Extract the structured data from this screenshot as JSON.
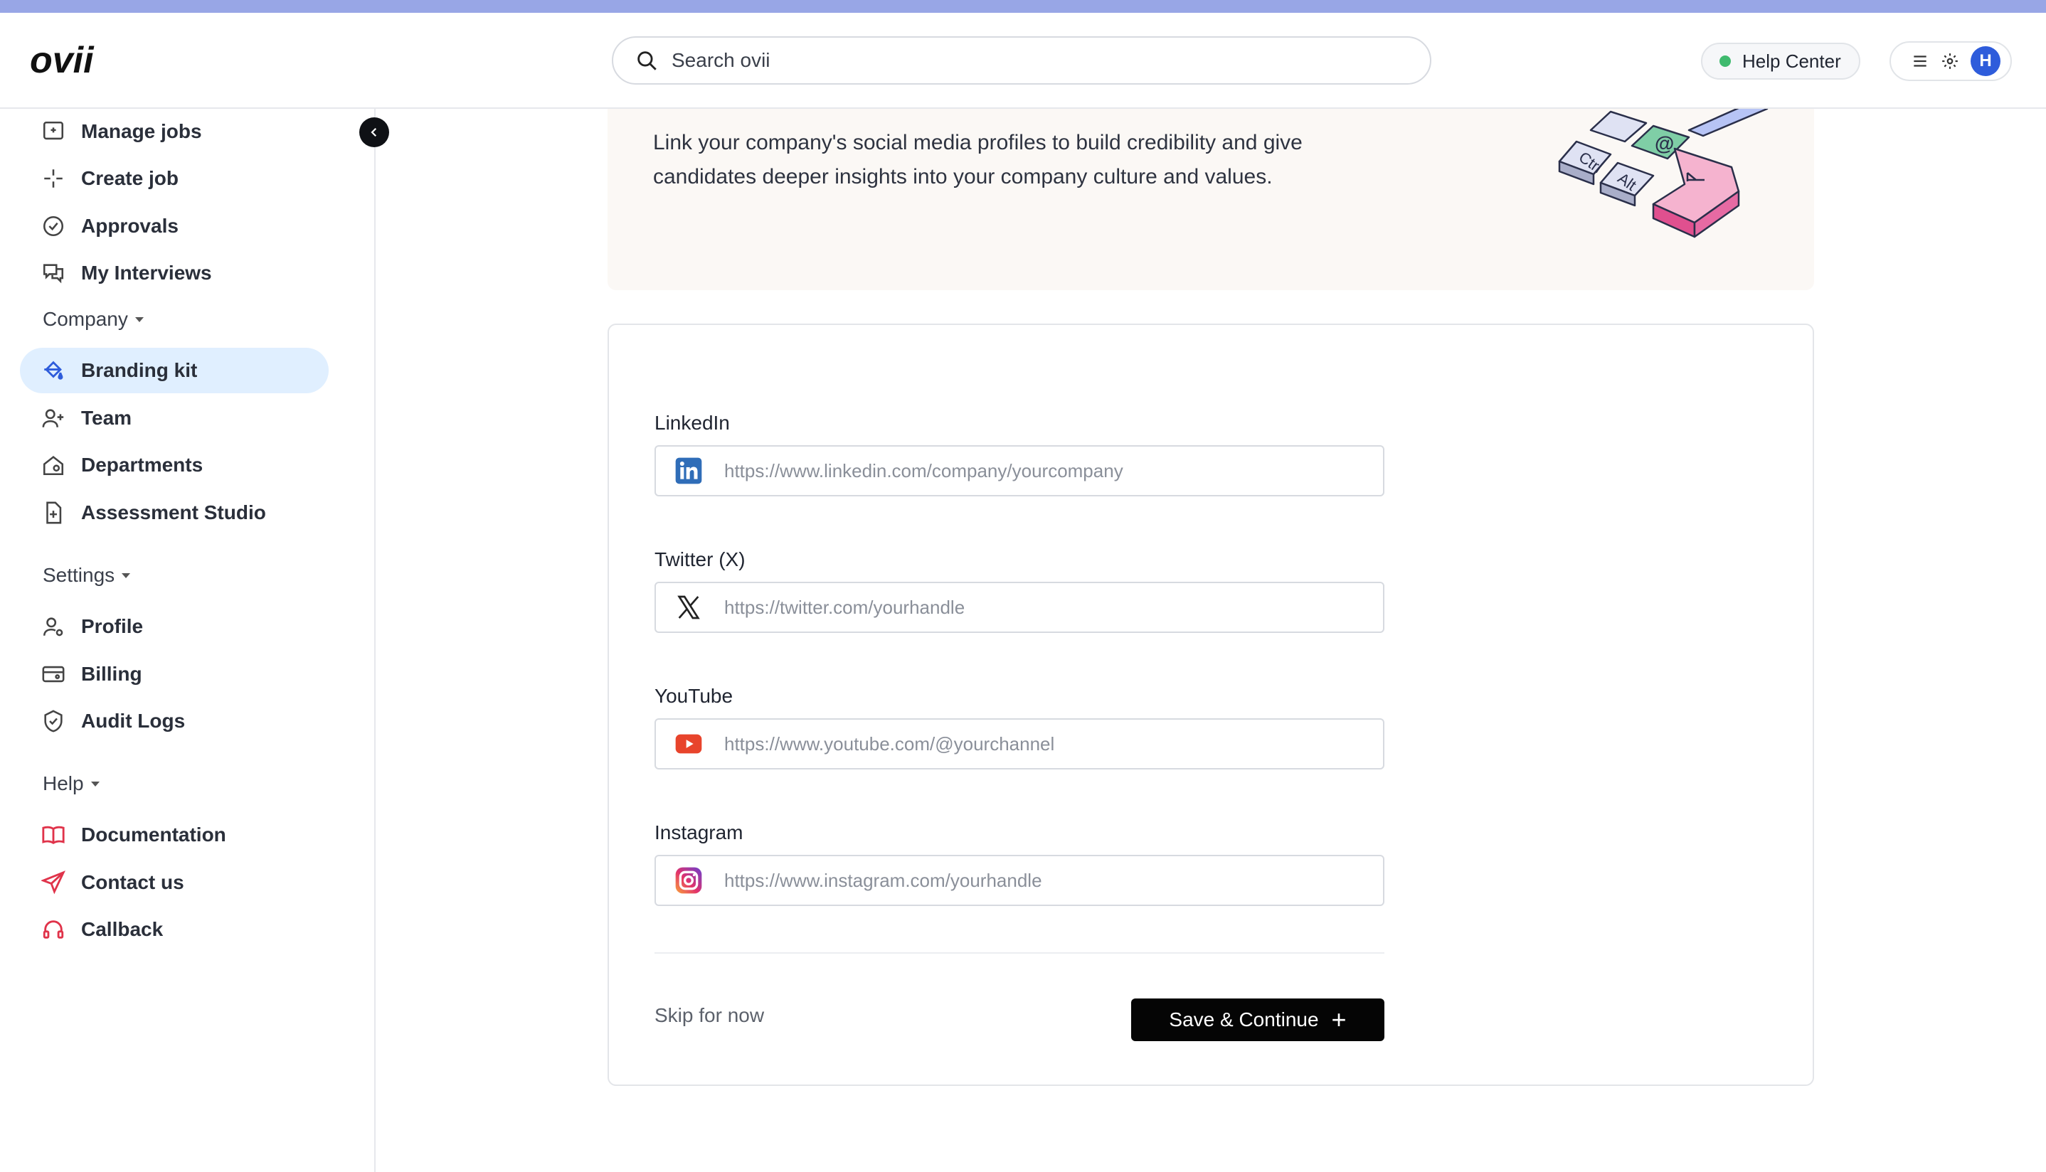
{
  "brand": {
    "logo_text": "ovii"
  },
  "search": {
    "placeholder": "Search ovii"
  },
  "header": {
    "help_label": "Help Center",
    "avatar_initial": "H"
  },
  "sidebar": {
    "items_top": [
      {
        "label": "Manage jobs",
        "icon": "briefcase-icon"
      },
      {
        "label": "Create job",
        "icon": "sparkle-icon"
      },
      {
        "label": "Approvals",
        "icon": "check-circle-icon"
      },
      {
        "label": "My Interviews",
        "icon": "chat-icon"
      }
    ],
    "company_section": "Company",
    "company_items": [
      {
        "label": "Branding kit",
        "icon": "paint-bucket-icon",
        "active": true
      },
      {
        "label": "Team",
        "icon": "user-plus-icon"
      },
      {
        "label": "Departments",
        "icon": "building-icon"
      },
      {
        "label": "Assessment Studio",
        "icon": "document-plus-icon"
      }
    ],
    "settings_section": "Settings",
    "settings_items": [
      {
        "label": "Profile",
        "icon": "user-gear-icon"
      },
      {
        "label": "Billing",
        "icon": "credit-card-icon"
      },
      {
        "label": "Audit Logs",
        "icon": "shield-check-icon"
      }
    ],
    "help_section": "Help",
    "help_items": [
      {
        "label": "Documentation",
        "icon": "book-icon"
      },
      {
        "label": "Contact us",
        "icon": "send-icon"
      },
      {
        "label": "Callback",
        "icon": "headset-icon"
      }
    ]
  },
  "banner": {
    "text": "Link your company's social media profiles to build credibility and give candidates deeper insights into your company culture and values."
  },
  "form": {
    "linkedin": {
      "label": "LinkedIn",
      "placeholder": "https://www.linkedin.com/company/yourcompany"
    },
    "twitter": {
      "label": "Twitter (X)",
      "placeholder": "https://twitter.com/yourhandle"
    },
    "youtube": {
      "label": "YouTube",
      "placeholder": "https://www.youtube.com/@yourchannel"
    },
    "instagram": {
      "label": "Instagram",
      "placeholder": "https://www.instagram.com/yourhandle"
    },
    "skip_label": "Skip for now",
    "save_label": "Save & Continue"
  },
  "colors": {
    "accent": "#2e5cdb",
    "active_bg": "#e0efff",
    "help_icons": "#e0334a",
    "status_green": "#3fba6e"
  }
}
